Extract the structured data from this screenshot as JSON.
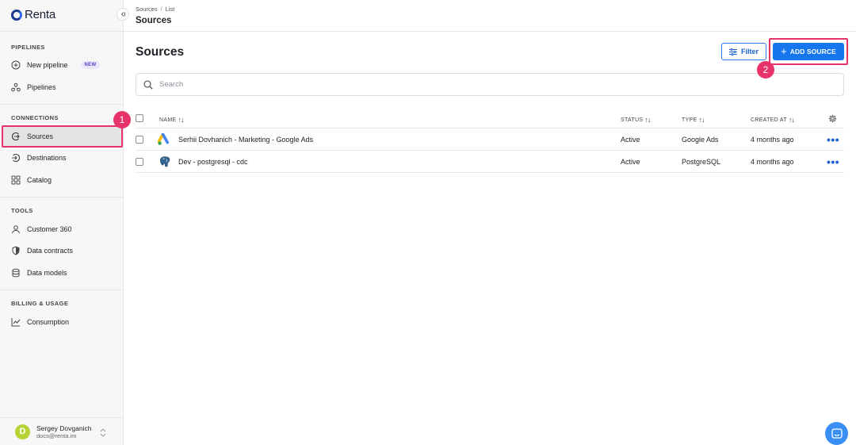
{
  "brand": {
    "name": "Renta"
  },
  "sidebar": {
    "sections": [
      {
        "title": "PIPELINES",
        "items": [
          {
            "label": "New pipeline",
            "icon": "plus-circle-icon",
            "badge": "NEW"
          },
          {
            "label": "Pipelines",
            "icon": "pipelines-icon"
          }
        ]
      },
      {
        "title": "CONNECTIONS",
        "items": [
          {
            "label": "Sources",
            "icon": "source-icon",
            "active": true
          },
          {
            "label": "Destinations",
            "icon": "destination-icon"
          },
          {
            "label": "Catalog",
            "icon": "catalog-icon"
          }
        ]
      },
      {
        "title": "TOOLS",
        "items": [
          {
            "label": "Customer 360",
            "icon": "user-icon"
          },
          {
            "label": "Data contracts",
            "icon": "shield-icon"
          },
          {
            "label": "Data models",
            "icon": "database-icon"
          }
        ]
      },
      {
        "title": "BILLING & USAGE",
        "items": [
          {
            "label": "Consumption",
            "icon": "chart-icon"
          }
        ]
      }
    ],
    "user": {
      "initial": "D",
      "name": "Sergey Dovganich",
      "email": "docs@renta.im"
    }
  },
  "header": {
    "breadcrumb": [
      "Sources",
      "List"
    ],
    "title": "Sources"
  },
  "main": {
    "title": "Sources",
    "filter_label": "Filter",
    "add_label": "ADD SOURCE",
    "search": {
      "placeholder": "Search",
      "value": ""
    },
    "columns": [
      "NAME",
      "STATUS",
      "TYPE",
      "CREATED AT"
    ],
    "rows": [
      {
        "name": "Serhii Dovhanich - Marketing - Google Ads",
        "status": "Active",
        "type": "Google Ads",
        "created": "4 months ago",
        "icon": "google-ads-icon"
      },
      {
        "name": "Dev - postgresql - cdc",
        "status": "Active",
        "type": "PostgreSQL",
        "created": "4 months ago",
        "icon": "postgresql-icon"
      }
    ]
  },
  "annotations": {
    "step1": "1",
    "step2": "2"
  },
  "colors": {
    "accent": "#1676ee",
    "highlight": "#e8336a",
    "active_bg": "#e4e4e7"
  }
}
